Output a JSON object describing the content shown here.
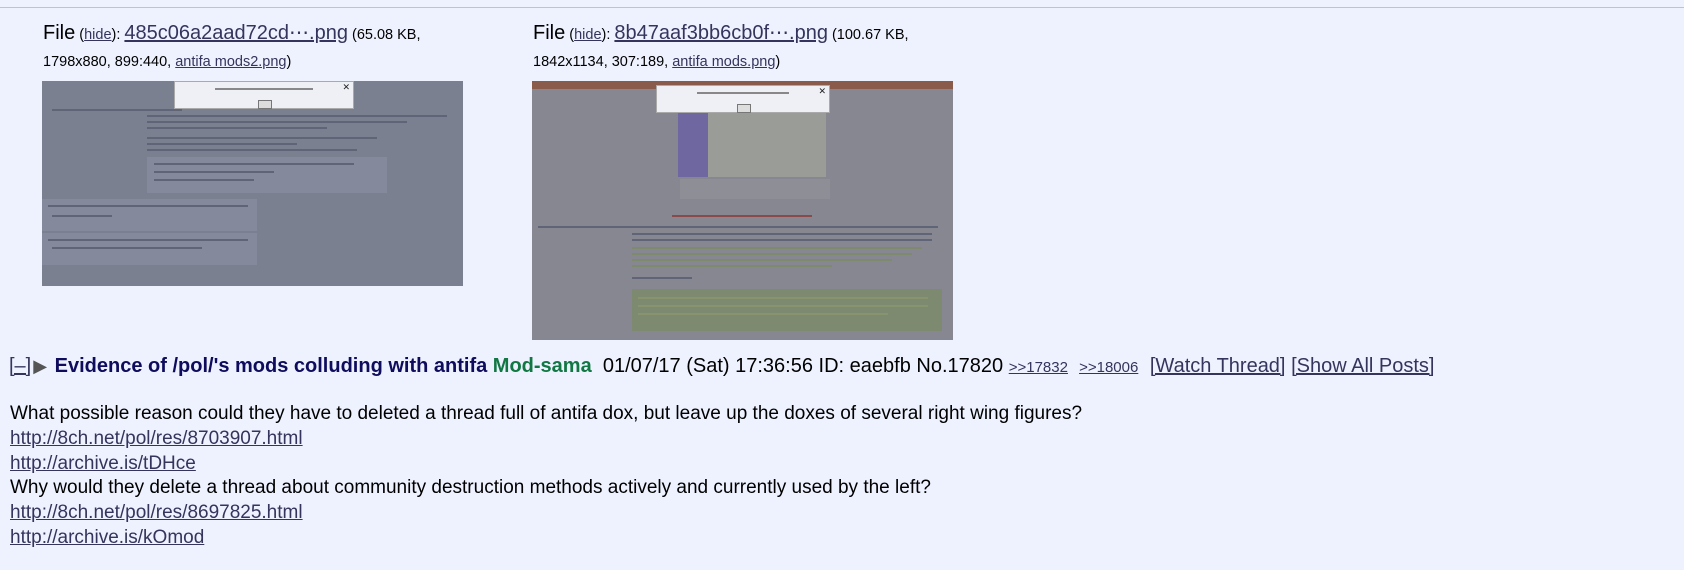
{
  "files": [
    {
      "label": "File",
      "hide": "hide",
      "filename": "485c06a2aad72cd⋯.png",
      "size_prefix": "(65.08 KB,",
      "dims": "1798x880, 899:440,",
      "original": "antifa mods2.png",
      "close": ")"
    },
    {
      "label": "File",
      "hide": "hide",
      "filename": "8b47aaf3bb6cb0f⋯.png",
      "size_prefix": "(100.67 KB,",
      "dims": "1842x1134, 307:189,",
      "original": "antifa mods.png",
      "close": ")"
    }
  ],
  "post": {
    "toggle": "[–]",
    "subject": "Evidence of /pol/'s mods colluding with antifa",
    "name": "Mod-sama",
    "date": "01/07/17 (Sat) 17:36:56",
    "id": "ID: eaebfb",
    "number": "No.17820",
    "replies": [
      ">>17832",
      ">>18006"
    ],
    "watch": "[Watch Thread]",
    "show_all": "[Show All Posts]",
    "body": [
      "What possible reason could they have to deleted a thread full of antifa dox, but leave up the doxes of several right wing figures?",
      "http://8ch.net/pol/res/8703907.html",
      "http://archive.is/tDHce",
      "Why would they delete a thread about community destruction methods actively and currently used by the left?",
      "http://8ch.net/pol/res/8697825.html",
      "http://archive.is/kOmod"
    ]
  }
}
